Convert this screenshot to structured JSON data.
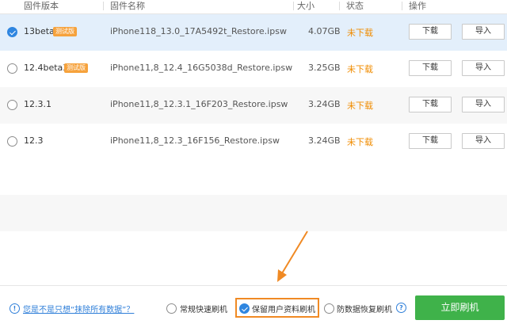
{
  "header": {
    "col_version": "固件版本",
    "col_name": "固件名称",
    "col_size": "大小",
    "col_status": "状态",
    "col_action": "操作"
  },
  "rows": [
    {
      "version": "13beta",
      "badge": "测试版",
      "filename": "iPhone118_13.0_17A5492t_Restore.ipsw",
      "size": "4.07GB",
      "status": "未下载",
      "download": "下载",
      "import": "导入",
      "selected": true
    },
    {
      "version": "12.4beta3",
      "badge": "测试版",
      "filename": "iPhone11,8_12.4_16G5038d_Restore.ipsw",
      "size": "3.25GB",
      "status": "未下载",
      "download": "下载",
      "import": "导入",
      "selected": false
    },
    {
      "version": "12.3.1",
      "filename": "iPhone11,8_12.3.1_16F203_Restore.ipsw",
      "size": "3.24GB",
      "status": "未下载",
      "download": "下载",
      "import": "导入",
      "selected": false
    },
    {
      "version": "12.3",
      "filename": "iPhone11,8_12.3_16F156_Restore.ipsw",
      "size": "3.24GB",
      "status": "未下载",
      "download": "下载",
      "import": "导入",
      "selected": false
    }
  ],
  "footer": {
    "help_link": "您是不是只想“抹除所有数据”？",
    "options": [
      {
        "label": "常规快速刷机",
        "checked": false
      },
      {
        "label": "保留用户资料刷机",
        "checked": true
      },
      {
        "label": "防数据恢复刷机",
        "checked": false
      }
    ],
    "flash_button": "立即刷机"
  },
  "colors": {
    "accent_blue": "#2f86e0",
    "status_orange": "#f08c00",
    "flash_green": "#3fb24a",
    "highlight_orange": "#f08a24"
  },
  "icons": [
    "check-circle-icon",
    "radio-icon",
    "info-icon",
    "help-icon",
    "annotation-arrow"
  ]
}
